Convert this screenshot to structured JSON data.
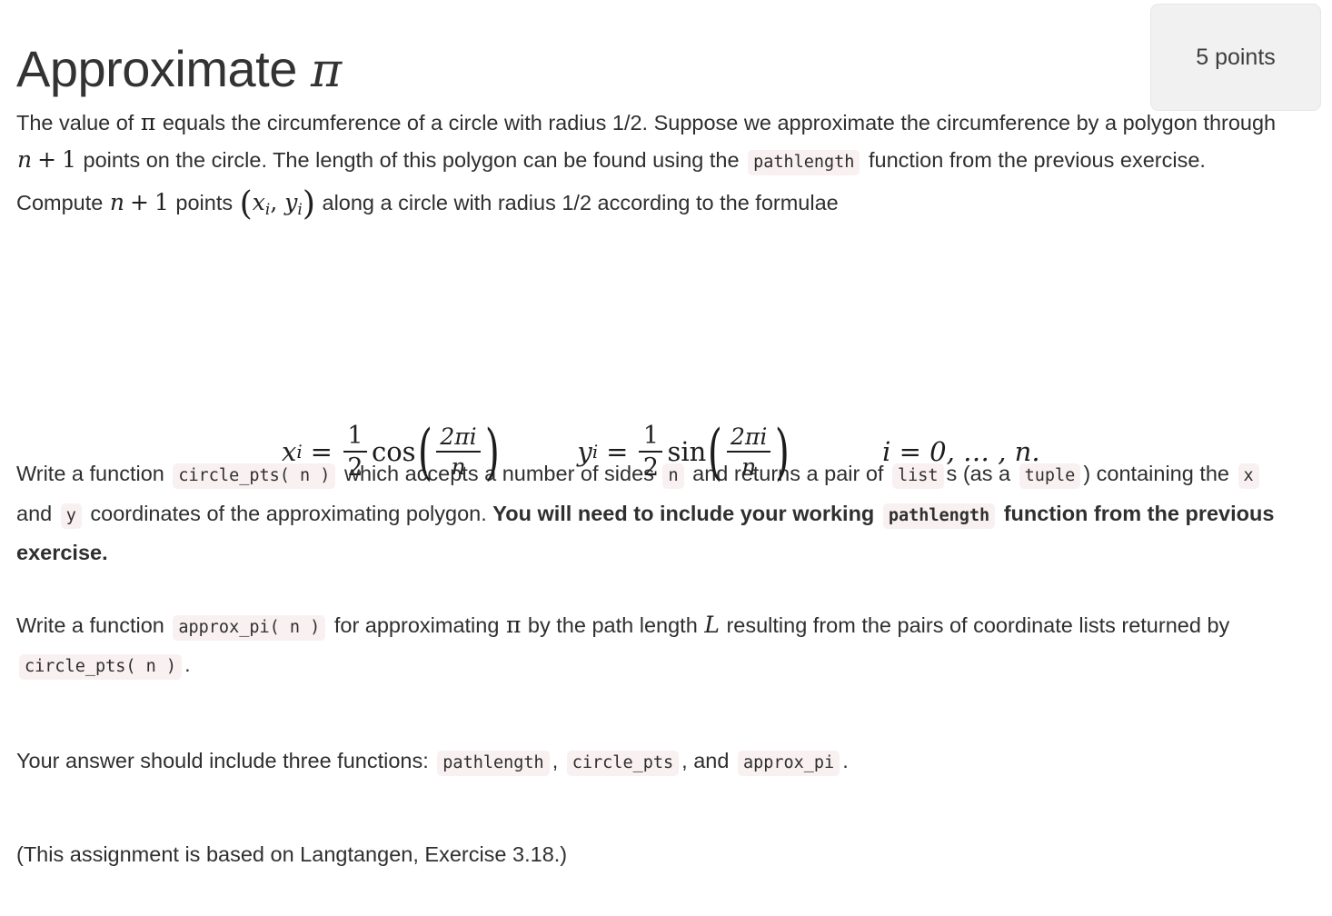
{
  "header": {
    "title_text": "Approximate",
    "title_symbol": "π",
    "points_badge": "5 points"
  },
  "content": {
    "intro": {
      "seg1": "The value of",
      "math_pi": "π",
      "seg2": "equals the circumference of a circle with radius 1/2. Suppose we approximate the circumference by a polygon through",
      "math_np1": "n + 1",
      "seg3": "points on the circle. The length of this polygon can be found using the",
      "code_pathlength": "pathlength",
      "seg4": "function from the previous exercise. Compute",
      "math_np1_b": "n + 1",
      "seg5": "points",
      "math_point": "(xᵢ, yᵢ)",
      "seg6": "along a circle with radius 1/2 according to the formulae"
    },
    "equation": {
      "lhs_x": "x",
      "lhs_y": "y",
      "sub_i": "i",
      "equals": "=",
      "half_num": "1",
      "half_den": "2",
      "cos": "cos",
      "sin": "sin",
      "arg_num": "2πi",
      "arg_den": "n",
      "range": "i = 0, … , n."
    },
    "para_circle_pts": {
      "seg1": "Write a function",
      "code_circle_pts": "circle_pts( n )",
      "seg2": "which accepts a number of sides",
      "code_n": "n",
      "seg3": "and returns a pair of",
      "code_list": "list",
      "seg4": "s (as a",
      "code_tuple": "tuple",
      "seg5": ") containing the",
      "code_x": "x",
      "seg6": "and",
      "code_y": "y",
      "seg7": "coordinates of the approximating polygon.",
      "bold1": "You will need to include your working",
      "code_pathlength_bold": "pathlength",
      "bold2": "function from the previous exercise."
    },
    "para_approx_pi": {
      "seg1": "Write a function",
      "code_approx_pi": "approx_pi( n )",
      "seg2": "for approximating",
      "math_pi": "π",
      "seg3": "by the path length",
      "math_L": "L",
      "seg4": "resulting from the pairs of coordinate lists returned by",
      "code_circle_pts": "circle_pts( n )",
      "seg5": "."
    },
    "para_three_functions": {
      "seg1": "Your answer should include three functions:",
      "code_pathlength": "pathlength",
      "sep1": ",",
      "code_circle_pts": "circle_pts",
      "sep2": ", and",
      "code_approx_pi": "approx_pi",
      "sep3": "."
    },
    "para_source": "(This assignment is based on Langtangen, Exercise 3.18.)"
  },
  "colors": {
    "page_background": "#ffffff",
    "text": "#2f2f2f",
    "title": "#333333",
    "code_background": "#f9f0f1",
    "badge_background": "#f1f1f1",
    "badge_border": "#e6e6e6"
  }
}
